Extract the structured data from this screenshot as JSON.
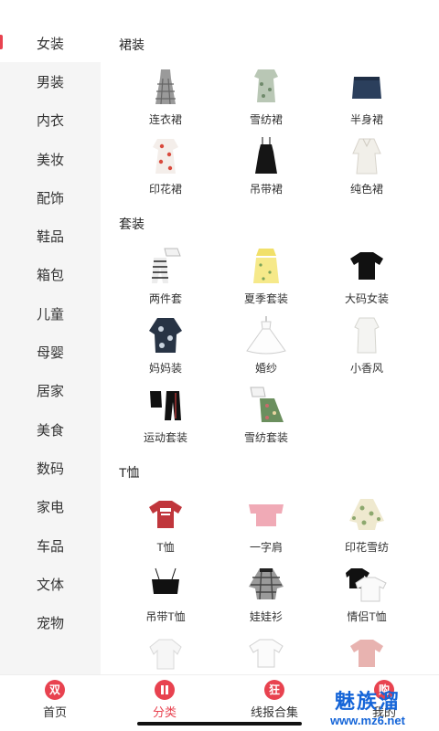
{
  "sidebar": {
    "items": [
      "女装",
      "男装",
      "内衣",
      "美妆",
      "配饰",
      "鞋品",
      "箱包",
      "儿童",
      "母婴",
      "居家",
      "美食",
      "数码",
      "家电",
      "车品",
      "文体",
      "宠物"
    ],
    "active_index": 0
  },
  "sections": [
    {
      "title": "裙装",
      "items": [
        {
          "label": "连衣裙",
          "icon": "plaid-dress-icon"
        },
        {
          "label": "雪纺裙",
          "icon": "floral-dress-icon"
        },
        {
          "label": "半身裙",
          "icon": "denim-skirt-icon"
        },
        {
          "label": "印花裙",
          "icon": "print-dress-icon"
        },
        {
          "label": "吊带裙",
          "icon": "slip-dress-icon"
        },
        {
          "label": "纯色裙",
          "icon": "white-dress-icon"
        }
      ]
    },
    {
      "title": "套装",
      "items": [
        {
          "label": "两件套",
          "icon": "two-piece-icon"
        },
        {
          "label": "夏季套装",
          "icon": "summer-set-icon"
        },
        {
          "label": "大码女装",
          "icon": "black-tee-icon"
        },
        {
          "label": "妈妈装",
          "icon": "mom-outfit-icon"
        },
        {
          "label": "婚纱",
          "icon": "wedding-dress-icon"
        },
        {
          "label": "小香风",
          "icon": "white-tunic-icon"
        },
        {
          "label": "运动套装",
          "icon": "sport-set-icon"
        },
        {
          "label": "雪纺套装",
          "icon": "chiffon-set-icon"
        }
      ]
    },
    {
      "title": "T恤",
      "items": [
        {
          "label": "T恤",
          "icon": "red-tee-icon"
        },
        {
          "label": "一字肩",
          "icon": "off-shoulder-icon"
        },
        {
          "label": "印花雪纺",
          "icon": "print-chiffon-icon"
        },
        {
          "label": "吊带T恤",
          "icon": "crop-cami-icon"
        },
        {
          "label": "娃娃衫",
          "icon": "gingham-blouse-icon"
        },
        {
          "label": "情侣T恤",
          "icon": "couple-tee-icon"
        },
        {
          "label": "",
          "icon": "white-blouse-icon"
        },
        {
          "label": "",
          "icon": "white-tee-icon"
        },
        {
          "label": "",
          "icon": "pink-tee-icon"
        }
      ]
    }
  ],
  "bottom_nav": [
    {
      "badge": "双",
      "label": "首页"
    },
    {
      "badge": "",
      "label": "分类"
    },
    {
      "badge": "狂",
      "label": "线报合集"
    },
    {
      "badge": "购",
      "label": "我的"
    }
  ],
  "watermark": {
    "cn": "魅族溜",
    "url": "www.mz6.net"
  },
  "colors": {
    "accent": "#e8424f",
    "watermark": "#1565d8",
    "sidebar_bg": "#f5f5f5"
  }
}
